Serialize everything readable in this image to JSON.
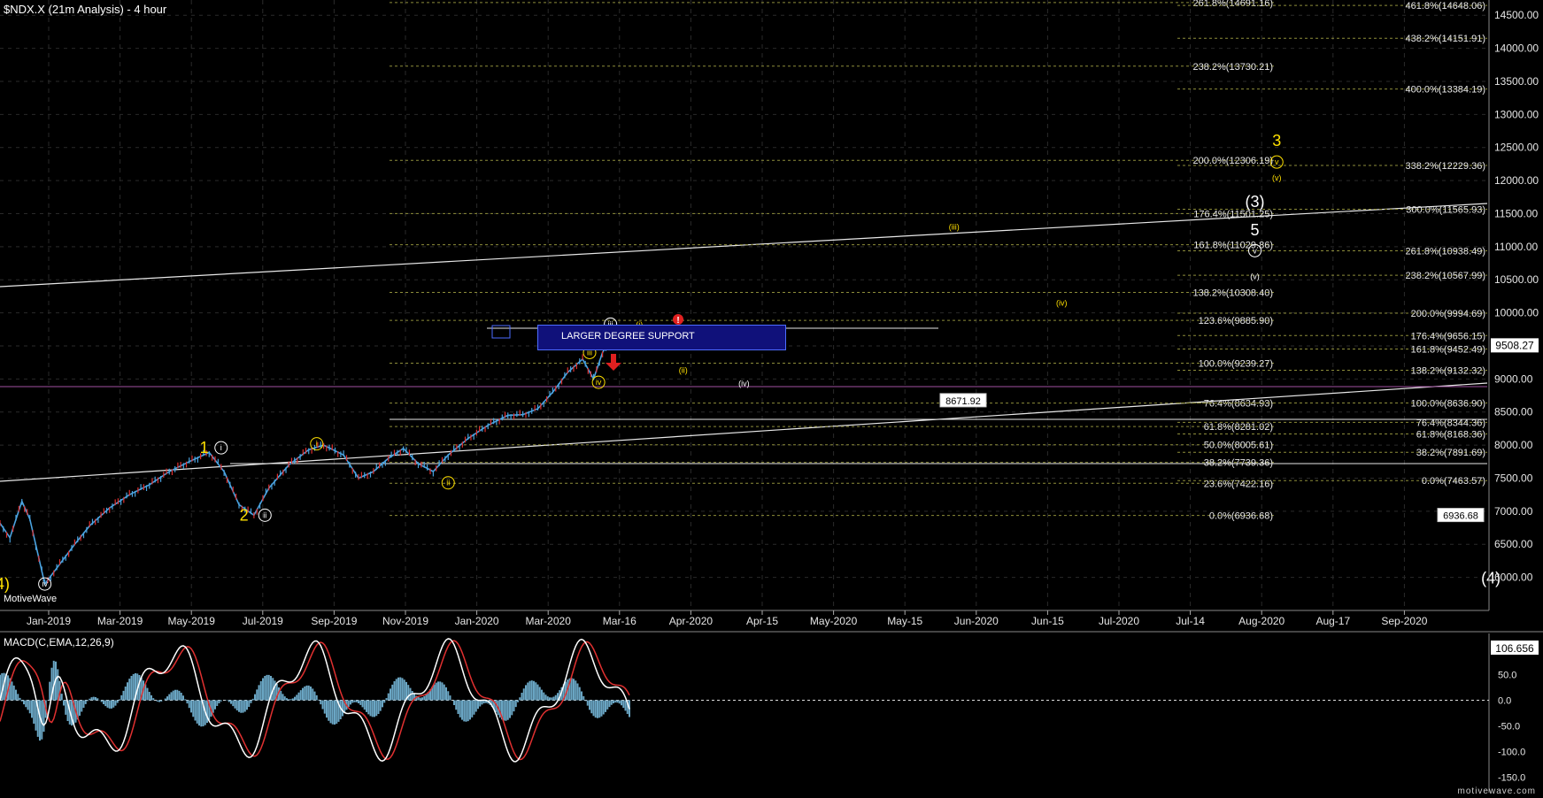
{
  "header": {
    "title": "$NDX.X (21m Analysis) - 4 hour"
  },
  "watermark": "MotiveWave",
  "brand": "motivewave.com",
  "macd": {
    "title": "MACD(C,EMA,12,26,9)",
    "last": "106.656",
    "ticks": [
      "50.0",
      "0.0",
      "-50.0",
      "-100.0",
      "-150.0"
    ],
    "tick_values": [
      50,
      0,
      -50,
      -100,
      -150
    ]
  },
  "support_box": {
    "label": "LARGER DEGREE SUPPORT"
  },
  "colors": {
    "background": "#000000",
    "fib_yellow": "#9a9a3a",
    "fib_white": "#dcdcdc",
    "macd_hist": "#6aa6c4",
    "macd_line": "#ffffff",
    "signal_line": "#e03030",
    "candle_up": "#4aa3e0",
    "candle_down": "#e03030"
  },
  "chart_data": {
    "type": "line",
    "title": "$NDX.X (21m Analysis) - 4 hour",
    "xlabel": "",
    "ylabel": "",
    "x_ticks": [
      "Jan-2019",
      "Mar-2019",
      "May-2019",
      "Jul-2019",
      "Sep-2019",
      "Nov-2019",
      "Jan-2020",
      "Mar-2020",
      "Mar-16",
      "Apr-2020",
      "Apr-15",
      "May-2020",
      "May-15",
      "Jun-2020",
      "Jun-15",
      "Jul-2020",
      "Jul-14",
      "Aug-2020",
      "Aug-17",
      "Sep-2020"
    ],
    "y_ticks": [
      6000,
      6500,
      7000,
      7500,
      8000,
      8500,
      9000,
      9500,
      10000,
      10500,
      11000,
      11500,
      12000,
      12500,
      13000,
      13500,
      14000,
      14500
    ],
    "y_tick_labels": [
      "6000.00",
      "6500.00",
      "7000.00",
      "7500.00",
      "8000.00",
      "8500.00",
      "9000.00",
      "9500.00",
      "10000.00",
      "10500.00",
      "11000.00",
      "11500.00",
      "12000.00",
      "12500.00",
      "13000.00",
      "13500.00",
      "14000.00",
      "14500.00"
    ],
    "ylim": [
      5500,
      14650
    ],
    "last_price": "9508.27",
    "last_value": 9508.27,
    "series": [
      {
        "points": [
          [
            0,
            6820
          ],
          [
            10,
            6600
          ],
          [
            22,
            7150
          ],
          [
            30,
            6880
          ],
          [
            45,
            5900
          ],
          [
            60,
            6200
          ],
          [
            75,
            6500
          ],
          [
            90,
            6780
          ],
          [
            110,
            7050
          ],
          [
            130,
            7250
          ],
          [
            150,
            7400
          ],
          [
            170,
            7600
          ],
          [
            190,
            7750
          ],
          [
            210,
            7890
          ],
          [
            225,
            7600
          ],
          [
            240,
            7100
          ],
          [
            255,
            6940
          ],
          [
            270,
            7350
          ],
          [
            290,
            7700
          ],
          [
            310,
            7930
          ],
          [
            325,
            8000
          ],
          [
            345,
            7850
          ],
          [
            360,
            7500
          ],
          [
            375,
            7600
          ],
          [
            390,
            7800
          ],
          [
            405,
            7950
          ],
          [
            420,
            7720
          ],
          [
            435,
            7600
          ],
          [
            450,
            7850
          ],
          [
            470,
            8100
          ],
          [
            490,
            8300
          ],
          [
            510,
            8450
          ],
          [
            525,
            8460
          ],
          [
            540,
            8550
          ],
          [
            555,
            8800
          ],
          [
            570,
            9100
          ],
          [
            585,
            9300
          ],
          [
            596,
            9000
          ],
          [
            605,
            9400
          ],
          [
            615,
            9650
          ],
          [
            625,
            9736
          ],
          [
            632,
            9508
          ]
        ]
      }
    ],
    "fib_levels_mid": [
      {
        "label": "261.8%(14691.16)",
        "value": 14691.16
      },
      {
        "label": "238.2%(13730.21)",
        "value": 13730.21
      },
      {
        "label": "200.0%(12306.19)",
        "value": 12306.19
      },
      {
        "label": "176.4%(11501.25)",
        "value": 11501.25
      },
      {
        "label": "161.8%(11029.86)",
        "value": 11029.86
      },
      {
        "label": "138.2%(10308.40)",
        "value": 10308.4
      },
      {
        "label": "123.6%(9885.90)",
        "value": 9885.9
      },
      {
        "label": "100.0%(9239.27)",
        "value": 9239.27
      },
      {
        "label": "76.4%(8634.93)",
        "value": 8634.93
      },
      {
        "label": "61.8%(8281.02)",
        "value": 8281.02
      },
      {
        "label": "50.0%(8005.61)",
        "value": 8005.61
      },
      {
        "label": "38.2%(7739.36)",
        "value": 7739.36
      },
      {
        "label": "23.6%(7422.16)",
        "value": 7422.16
      },
      {
        "label": "0.0%(6936.68)",
        "value": 6936.68
      }
    ],
    "fib_levels_right": [
      {
        "label": "461.8%(14648.06)",
        "value": 14648.06
      },
      {
        "label": "438.2%(14151.91)",
        "value": 14151.91
      },
      {
        "label": "400.0%(13384.19)",
        "value": 13384.19
      },
      {
        "label": "338.2%(12229.36)",
        "value": 12229.36
      },
      {
        "label": "300.0%(11565.93)",
        "value": 11565.93
      },
      {
        "label": "261.8%(10938.49)",
        "value": 10938.49
      },
      {
        "label": "238.2%(10567.99)",
        "value": 10567.99
      },
      {
        "label": "200.0%(9994.69)",
        "value": 9994.69
      },
      {
        "label": "176.4%(9656.15)",
        "value": 9656.15
      },
      {
        "label": "161.8%(9452.49)",
        "value": 9452.49
      },
      {
        "label": "138.2%(9132.32)",
        "value": 9132.32
      },
      {
        "label": "100.0%(8636.90)",
        "value": 8636.9
      },
      {
        "label": "76.4%(8344.36)",
        "value": 8344.36
      },
      {
        "label": "61.8%(8168.36)",
        "value": 8168.36
      },
      {
        "label": "38.2%(7891.69)",
        "value": 7891.69
      },
      {
        "label": "0.0%(7463.57)",
        "value": 7463.57
      }
    ],
    "price_tags": [
      {
        "label": "8671.92",
        "value": 8671.92
      },
      {
        "label": "6936.68",
        "value": 6936.68
      }
    ],
    "wave_labels": [
      {
        "text": "(4)",
        "color": "#ffe000",
        "price": 5900,
        "bar": 0
      },
      {
        "text": "iv",
        "color": "#ffffff",
        "circled": true,
        "price": 5900,
        "bar": 45
      },
      {
        "text": "1",
        "color": "#ffe000",
        "price": 7960,
        "bar": 205
      },
      {
        "text": "i",
        "color": "#ffffff",
        "circled": true,
        "price": 7960,
        "bar": 222
      },
      {
        "text": "2",
        "color": "#ffe000",
        "price": 6940,
        "bar": 245
      },
      {
        "text": "ii",
        "color": "#ffffff",
        "circled": true,
        "price": 6940,
        "bar": 266
      },
      {
        "text": "i",
        "color": "#ffe000",
        "circled": true,
        "price": 8020,
        "bar": 318
      },
      {
        "text": "ii",
        "color": "#ffe000",
        "circled": true,
        "price": 7430,
        "bar": 450
      },
      {
        "text": "iii",
        "color": "#ffe000",
        "circled": true,
        "price": 9400,
        "bar": 592
      },
      {
        "text": "iv",
        "color": "#ffe000",
        "circled": true,
        "price": 8950,
        "bar": 601
      },
      {
        "text": "iii",
        "color": "#ffffff",
        "circled": true,
        "price": 9830,
        "bar": 613
      },
      {
        "text": "(i)",
        "color": "#ffe000",
        "price": 9820,
        "bar": 642
      },
      {
        "text": "(ii)",
        "color": "#ffe000",
        "price": 9130,
        "bar": 686
      },
      {
        "text": "(iv)",
        "color": "#ffffff",
        "price": 8930,
        "bar": 747
      },
      {
        "text": "(iii)",
        "color": "#ffe000",
        "price": 11300,
        "bar": 958
      },
      {
        "text": "(iv)",
        "color": "#ffe000",
        "price": 10150,
        "bar": 1066
      },
      {
        "text": "(3)",
        "color": "#ffffff",
        "price": 11680,
        "bar": 1260
      },
      {
        "text": "5",
        "color": "#ffffff",
        "price": 11250,
        "bar": 1260
      },
      {
        "text": "v",
        "color": "#ffffff",
        "circled": true,
        "price": 10940,
        "bar": 1260
      },
      {
        "text": "(v)",
        "color": "#ffffff",
        "price": 10550,
        "bar": 1260
      },
      {
        "text": "3",
        "color": "#ffe000",
        "price": 12600,
        "bar": 1282
      },
      {
        "text": "v",
        "color": "#ffe000",
        "circled": true,
        "price": 12280,
        "bar": 1282
      },
      {
        "text": "(v)",
        "color": "#ffe000",
        "price": 12040,
        "bar": 1282
      },
      {
        "text": "(4)",
        "color": "#ffffff",
        "price": 5990,
        "bar": 1497
      }
    ],
    "grid": true
  }
}
